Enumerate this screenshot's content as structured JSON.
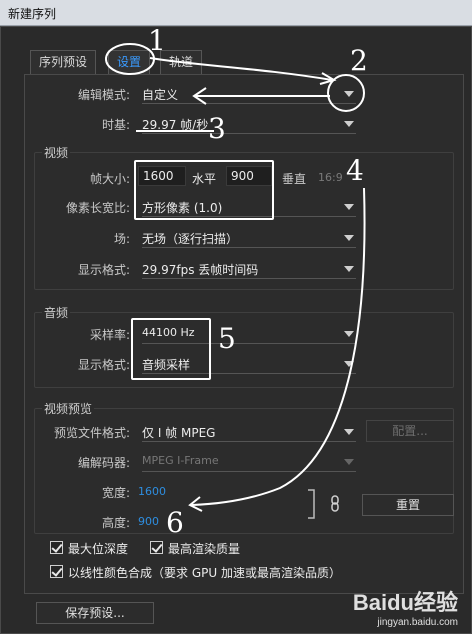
{
  "window": {
    "title": "新建序列"
  },
  "tabs": [
    {
      "label": "序列预设"
    },
    {
      "label": "设置"
    },
    {
      "label": "轨道"
    }
  ],
  "editing_mode": {
    "label": "编辑模式:",
    "value": "自定义"
  },
  "timebase": {
    "label": "时基:",
    "value": "29.97 帧/秒"
  },
  "video": {
    "title": "视频",
    "frame_size_label": "帧大小:",
    "frame_width": "1600",
    "horizontal_label": "水平",
    "frame_height": "900",
    "vertical_label": "垂直",
    "aspect": "16:9",
    "pixel_aspect_label": "像素长宽比:",
    "pixel_aspect_value": "方形像素 (1.0)",
    "fields_label": "场:",
    "fields_value": "无场（逐行扫描）",
    "display_format_label": "显示格式:",
    "display_format_value": "29.97fps 丢帧时间码"
  },
  "audio": {
    "title": "音频",
    "sample_rate_label": "采样率:",
    "sample_rate_value": "44100 Hz",
    "display_format_label": "显示格式:",
    "display_format_value": "音频采样"
  },
  "preview": {
    "title": "视频预览",
    "file_format_label": "预览文件格式:",
    "file_format_value": "仅 I 帧 MPEG",
    "configure_label": "配置...",
    "codec_label": "编解码器:",
    "codec_value": "MPEG I-Frame",
    "width_label": "宽度:",
    "width_value": "1600",
    "height_label": "高度:",
    "height_value": "900",
    "reset_label": "重置"
  },
  "options": {
    "max_bit_depth": "最大位深度",
    "max_render_quality": "最高渲染质量",
    "linear_color": "以线性颜色合成（要求 GPU 加速或最高渲染品质）"
  },
  "save_preset_label": "保存预设...",
  "annotations": [
    "1",
    "2",
    "3",
    "4",
    "5",
    "6"
  ],
  "watermark": {
    "brand": "Baidu经验",
    "url": "jingyan.baidu.com"
  }
}
